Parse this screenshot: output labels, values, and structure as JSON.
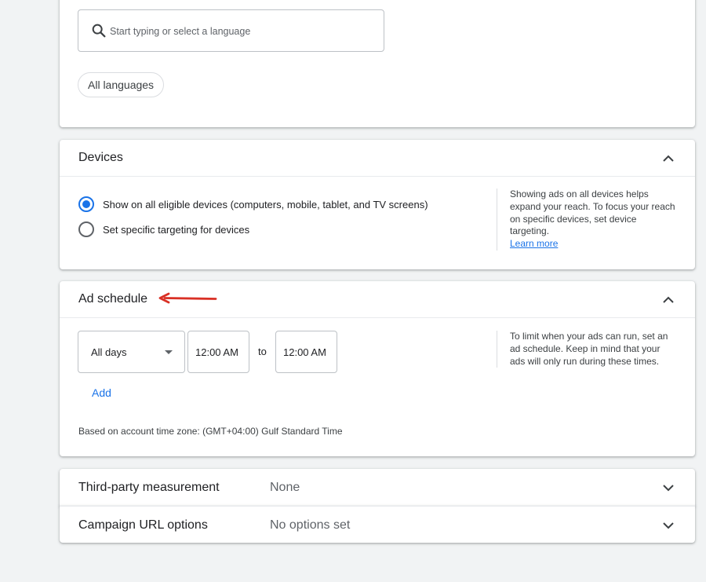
{
  "languages": {
    "search_placeholder": "Start typing or select a language",
    "chip_label": "All languages"
  },
  "devices": {
    "title": "Devices",
    "options": [
      {
        "label": "Show on all eligible devices (computers, mobile, tablet, and TV screens)",
        "checked": true
      },
      {
        "label": "Set specific targeting for devices",
        "checked": false
      }
    ],
    "help_text": "Showing ads on all devices helps expand your reach. To focus your reach on specific devices, set device targeting.",
    "help_link": "Learn more"
  },
  "ad_schedule": {
    "title": "Ad schedule",
    "day_select": "All days",
    "start_time": "12:00 AM",
    "to_label": "to",
    "end_time": "12:00 AM",
    "add_label": "Add",
    "timezone_note": "Based on account time zone: (GMT+04:00) Gulf Standard Time",
    "help_text": "To limit when your ads can run, set an ad schedule. Keep in mind that your ads will only run during these times."
  },
  "third_party": {
    "title": "Third-party measurement",
    "value": "None"
  },
  "campaign_url": {
    "title": "Campaign URL options",
    "value": "No options set"
  },
  "colors": {
    "accent": "#1a73e8",
    "annotation_arrow": "#d93025"
  }
}
